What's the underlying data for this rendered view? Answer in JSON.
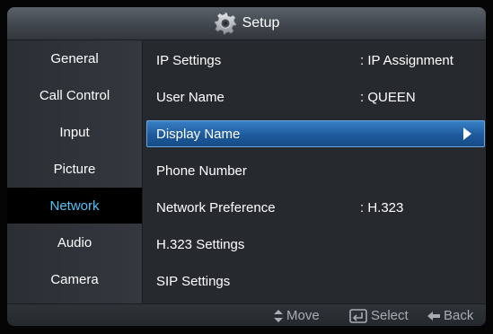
{
  "header": {
    "title": "Setup",
    "icon": "gear-icon"
  },
  "sidebar": {
    "items": [
      {
        "label": "General"
      },
      {
        "label": "Call Control"
      },
      {
        "label": "Input"
      },
      {
        "label": "Picture"
      },
      {
        "label": "Network",
        "active": true
      },
      {
        "label": "Audio"
      },
      {
        "label": "Camera"
      }
    ]
  },
  "main": {
    "rows": [
      {
        "label": "IP Settings",
        "value": ": IP Assignment"
      },
      {
        "label": "User Name",
        "value": ": QUEEN"
      },
      {
        "label": "Display Name",
        "value": "",
        "selected": true
      },
      {
        "label": "Phone Number",
        "value": ""
      },
      {
        "label": "Network Preference",
        "value": ": H.323"
      },
      {
        "label": "H.323 Settings",
        "value": ""
      },
      {
        "label": "SIP Settings",
        "value": ""
      }
    ]
  },
  "footer": {
    "move": "Move",
    "select": "Select",
    "back": "Back"
  },
  "colors": {
    "accent": "#4fc3f7",
    "selection": "#2a6fb4",
    "text": "#ffffff",
    "hint": "#a7adb3"
  }
}
